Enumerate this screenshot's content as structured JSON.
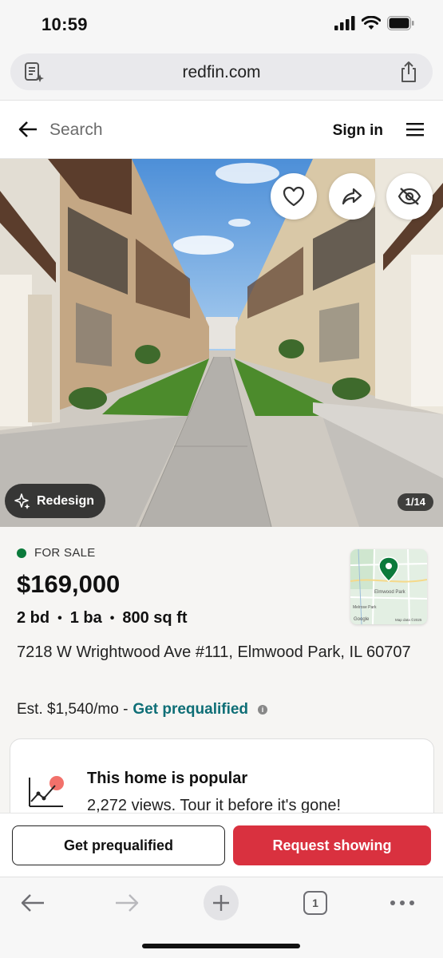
{
  "status_bar": {
    "time": "10:59"
  },
  "browser": {
    "url": "redfin.com",
    "tab_count": "1"
  },
  "header": {
    "search_placeholder": "Search",
    "sign_in": "Sign in"
  },
  "photo": {
    "redesign_label": "Redesign",
    "counter": "1/14"
  },
  "listing": {
    "status": "FOR SALE",
    "price": "$169,000",
    "beds": "2 bd",
    "baths": "1 ba",
    "sqft": "800 sq ft",
    "address": "7218 W Wrightwood Ave #111, Elmwood Park, IL 60707",
    "estimate": "Est. $1,540/mo -",
    "prequal_link": "Get prequalified",
    "info_glyph": "i"
  },
  "map": {
    "label_elmwood": "Elmwood Park",
    "label_melrose": "Melrose Park",
    "google": "Google",
    "map_data": "Map data ©2025"
  },
  "popular": {
    "title": "This home is popular",
    "subtitle": "2,272 views. Tour it before it's gone!"
  },
  "actions": {
    "prequal_button": "Get prequalified",
    "request_button": "Request showing"
  },
  "colors": {
    "accent_red": "#d9313f",
    "link_teal": "#0e6e76",
    "status_green": "#0b7a3b"
  }
}
